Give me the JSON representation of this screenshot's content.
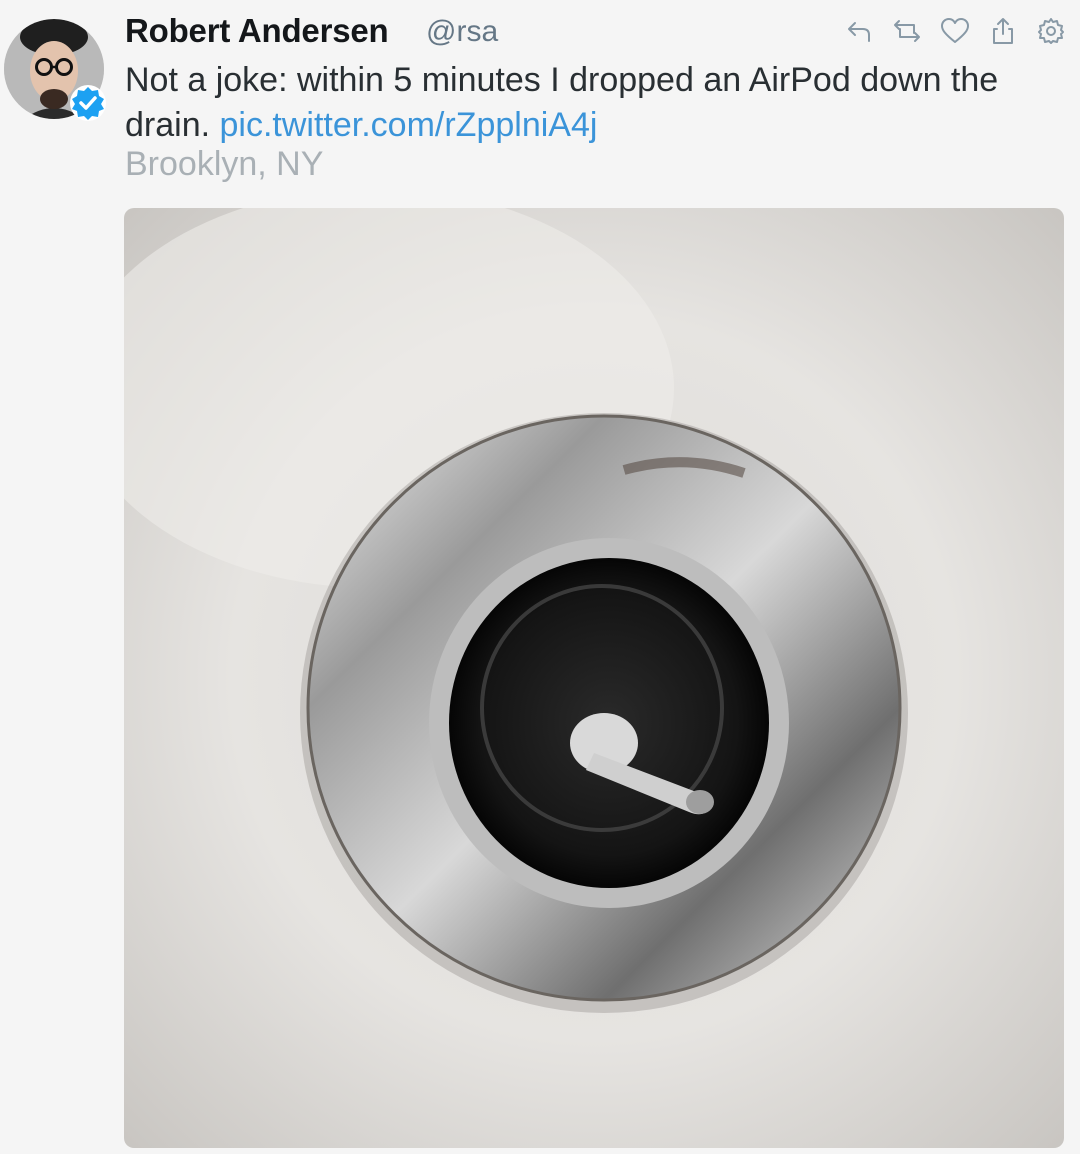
{
  "tweet": {
    "author_name": "Robert Andersen",
    "author_handle": "@rsa",
    "text": "Not a joke: within 5 minutes I dropped an AirPod down the drain.",
    "link": "pic.twitter.com/rZpplniA4j",
    "location": "Brooklyn, NY",
    "verified": true,
    "photo_subject": "AirPod in a sink drain"
  },
  "actions": [
    {
      "name": "reply",
      "icon": "reply-icon"
    },
    {
      "name": "retweet",
      "icon": "retweet-icon"
    },
    {
      "name": "like",
      "icon": "heart-icon"
    },
    {
      "name": "share",
      "icon": "share-icon"
    },
    {
      "name": "settings",
      "icon": "gear-icon"
    }
  ],
  "colors": {
    "link": "#3b94d9",
    "verified": "#1da1f2",
    "icon": "#8899a6",
    "location": "#a9b0b5"
  }
}
